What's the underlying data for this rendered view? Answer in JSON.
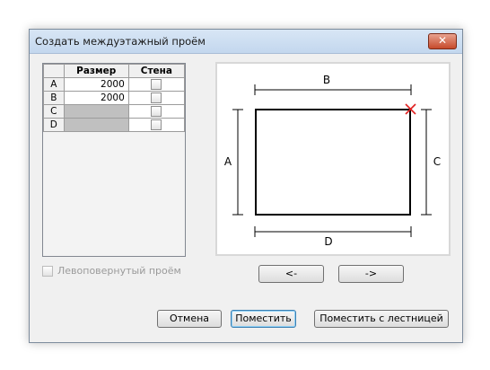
{
  "dialog": {
    "title": "Создать междуэтажный проём",
    "close_glyph": "✕"
  },
  "table": {
    "headers": [
      "",
      "Размер",
      "Стена"
    ],
    "rows": [
      {
        "label": "A",
        "size": "2000",
        "wall": false
      },
      {
        "label": "B",
        "size": "2000",
        "wall": false
      },
      {
        "label": "C",
        "size": "",
        "wall": false
      },
      {
        "label": "D",
        "size": "",
        "wall": false
      }
    ]
  },
  "left_opening_label": "Левоповернутый проём",
  "diagram": {
    "label_a": "A",
    "label_b": "B",
    "label_c": "C",
    "label_d": "D"
  },
  "nav": {
    "prev": "<-",
    "next": "->"
  },
  "buttons": {
    "cancel": "Отмена",
    "place": "Поместить",
    "place_stairs": "Поместить с лестницей"
  },
  "colors": {
    "marker": "#e02020",
    "accent": "#3c7fb1"
  }
}
